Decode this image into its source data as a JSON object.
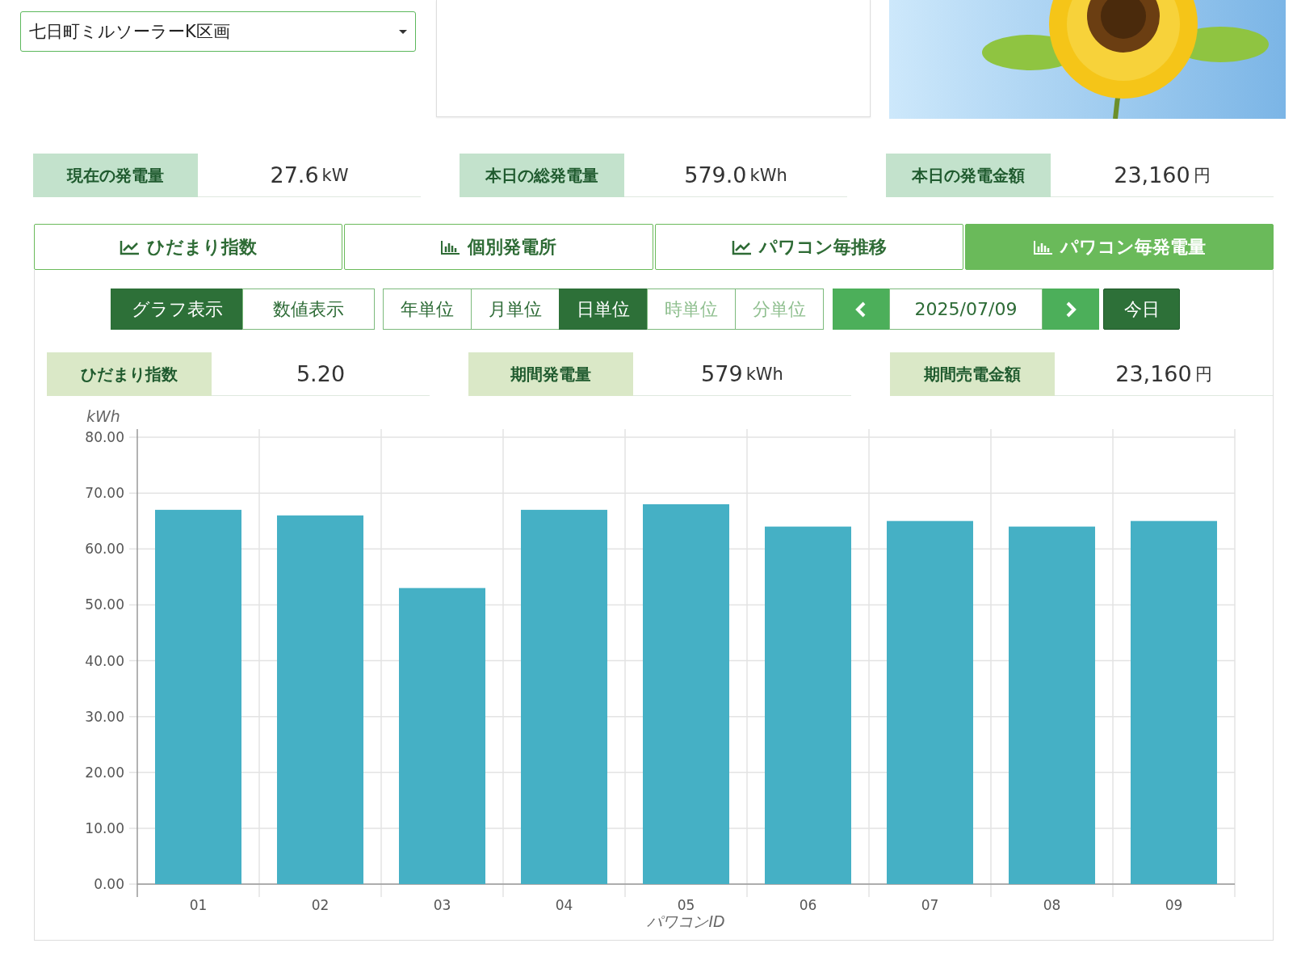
{
  "site_select": {
    "value": "七日町ミルソーラーK区画"
  },
  "summary": [
    {
      "label": "現在の発電量",
      "value": "27.6",
      "unit": "kW"
    },
    {
      "label": "本日の総発電量",
      "value": "579.0",
      "unit": "kWh"
    },
    {
      "label": "本日の発電金額",
      "value": "23,160",
      "unit": "円"
    }
  ],
  "tabs": [
    {
      "label": "ひだまり指数",
      "kind": "line",
      "selected": false
    },
    {
      "label": "個別発電所",
      "kind": "bar",
      "selected": false
    },
    {
      "label": "パワコン毎推移",
      "kind": "line",
      "selected": false
    },
    {
      "label": "パワコン毎発電量",
      "kind": "bar",
      "selected": true
    }
  ],
  "view_modes": [
    {
      "label": "グラフ表示",
      "selected": true
    },
    {
      "label": "数値表示",
      "selected": false
    }
  ],
  "units": [
    {
      "label": "年単位",
      "selected": false,
      "disabled": false
    },
    {
      "label": "月単位",
      "selected": false,
      "disabled": false
    },
    {
      "label": "日単位",
      "selected": true,
      "disabled": false
    },
    {
      "label": "時単位",
      "selected": false,
      "disabled": true
    },
    {
      "label": "分単位",
      "selected": false,
      "disabled": true
    }
  ],
  "date_nav": {
    "date": "2025/07/09",
    "today": "今日"
  },
  "period_stats": [
    {
      "label": "ひだまり指数",
      "value": "5.20"
    },
    {
      "label": "期間発電量",
      "value": "579",
      "unit": "kWh"
    },
    {
      "label": "期間売電金額",
      "value": "23,160",
      "unit": "円"
    }
  ],
  "chart_data": {
    "type": "bar",
    "xlabel": "パワコンID",
    "ylabel": "kWh",
    "categories": [
      "01",
      "02",
      "03",
      "04",
      "05",
      "06",
      "07",
      "08",
      "09"
    ],
    "series": [
      {
        "color": "#45b0c5",
        "values": [
          67,
          66,
          53,
          67,
          68,
          64,
          65,
          64,
          65
        ]
      }
    ],
    "grid": true,
    "ylim": [
      0,
      80
    ],
    "yticks": [
      {
        "value": 0,
        "label": "0.00"
      },
      {
        "value": 10,
        "label": "10.00"
      },
      {
        "value": 20,
        "label": "20.00"
      },
      {
        "value": 30,
        "label": "30.00"
      },
      {
        "value": 40,
        "label": "40.00"
      },
      {
        "value": 50,
        "label": "50.00"
      },
      {
        "value": 60,
        "label": "60.00"
      },
      {
        "value": 70,
        "label": "70.00"
      },
      {
        "value": 80,
        "label": "80.00"
      }
    ]
  }
}
